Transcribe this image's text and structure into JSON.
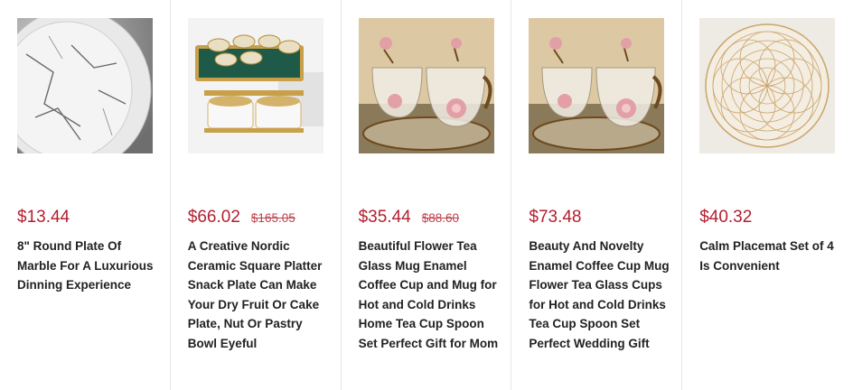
{
  "colors": {
    "price": "#b31f2e",
    "title": "#222222",
    "divider": "#e6e6e6"
  },
  "products": [
    {
      "image": "marble-plate-image",
      "price": "$13.44",
      "old_price": "",
      "title": "8\" Round Plate Of Marble For A Luxurious Dinning Experience"
    },
    {
      "image": "nordic-platter-image",
      "price": "$66.02",
      "old_price": "$165.05",
      "title": "A Creative Nordic Ceramic Square Platter Snack Plate Can Make Your Dry Fruit Or Cake Plate, Nut Or Pastry Bowl Eyeful"
    },
    {
      "image": "flower-tea-glass-image",
      "price": "$35.44",
      "old_price": "$88.60",
      "title": "Beautiful Flower Tea Glass Mug Enamel Coffee Cup and Mug for Hot and Cold Drinks Home Tea Cup Spoon Set Perfect Gift for Mom"
    },
    {
      "image": "enamel-coffee-cup-image",
      "price": "$73.48",
      "old_price": "",
      "title": "Beauty And Novelty Enamel Coffee Cup Mug Flower Tea Glass Cups for Hot and Cold Drinks Tea Cup Spoon Set Perfect Wedding Gift"
    },
    {
      "image": "placemat-image",
      "price": "$40.32",
      "old_price": "",
      "title": "Calm Placemat Set of 4 Is Convenient"
    }
  ]
}
